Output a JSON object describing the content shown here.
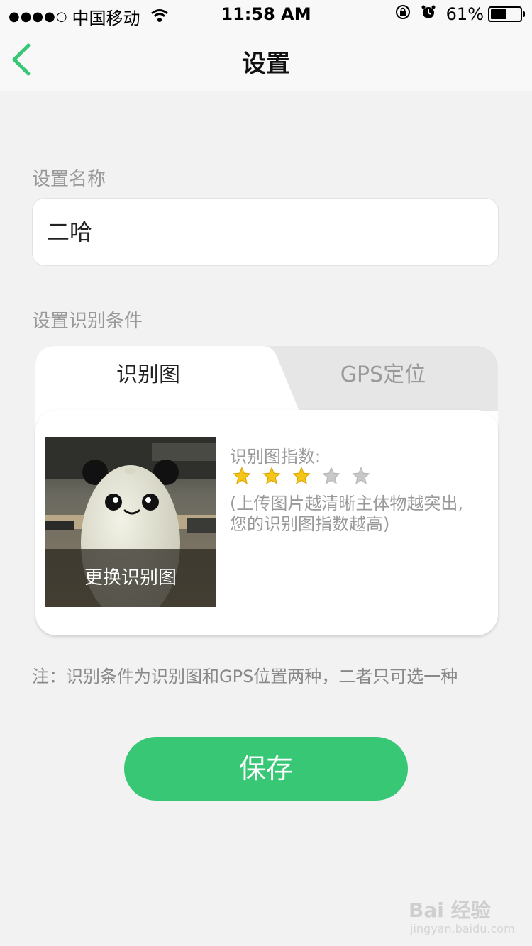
{
  "status_bar": {
    "signal": "●●●●○",
    "carrier": "中国移动",
    "time": "11:58 AM",
    "battery": "61%",
    "battery_level": 0.61
  },
  "nav": {
    "title": "设置"
  },
  "name_section": {
    "label": "设置名称",
    "value": "二哈"
  },
  "condition_section": {
    "label": "设置识别条件",
    "tabs": [
      {
        "label": "识别图",
        "active": true
      },
      {
        "label": "GPS定位",
        "active": false
      }
    ],
    "change_image_label": "更换识别图",
    "index_label": "识别图指数:",
    "rating": 3,
    "rating_max": 5,
    "hint": "(上传图片越清晰主体物越突出, 您的识别图指数越高)"
  },
  "note": "注：识别条件为识别图和GPS位置两种，二者只可选一种",
  "save_label": "保存",
  "watermark": {
    "main": "Bai 经验",
    "sub": "jingyan.baidu.com"
  },
  "colors": {
    "accent": "#37c775",
    "star_on": "#f5c518",
    "star_off": "#c8c8c8"
  }
}
